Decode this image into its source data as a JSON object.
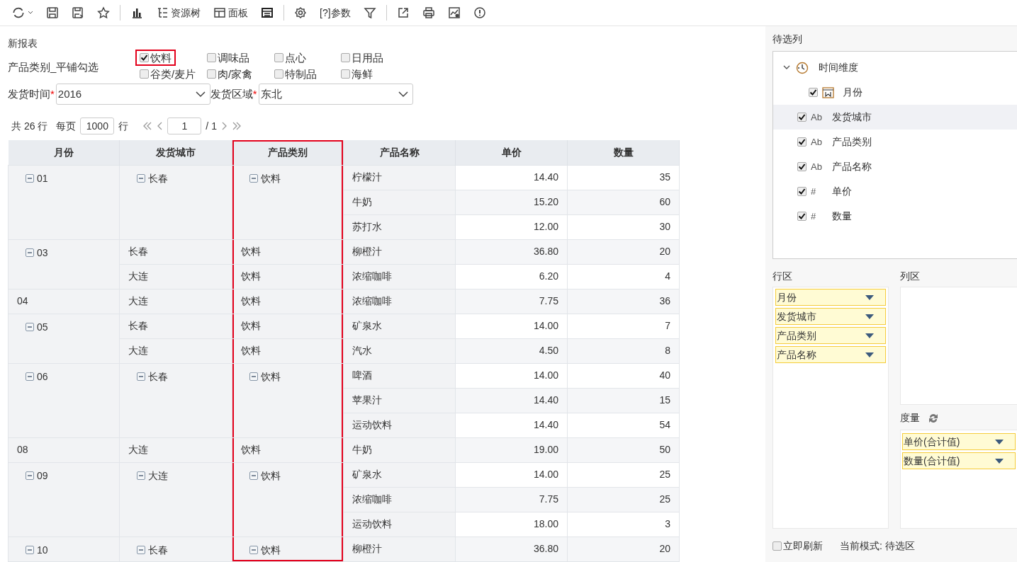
{
  "toolbar": [
    {
      "kind": "button",
      "caret": true
    },
    {
      "kind": "button"
    },
    {
      "kind": "button"
    },
    {
      "kind": "button"
    },
    {
      "kind": "separator"
    },
    {
      "kind": "button"
    },
    {
      "kind": "button",
      "label": "资源树"
    },
    {
      "kind": "button",
      "label": "面板"
    },
    {
      "kind": "button"
    },
    {
      "kind": "separator"
    },
    {
      "kind": "button"
    },
    {
      "kind": "button",
      "label": "[?]参数"
    },
    {
      "kind": "button"
    },
    {
      "kind": "separator"
    },
    {
      "kind": "button"
    },
    {
      "kind": "button"
    },
    {
      "kind": "button"
    },
    {
      "kind": "button"
    }
  ],
  "report_title": "新报表",
  "category_filter": {
    "label": "产品类别_平铺勾选",
    "options": [
      {
        "label": "饮料",
        "checked": true,
        "highlighted": true
      },
      {
        "label": "调味品",
        "checked": false,
        "highlighted": false
      },
      {
        "label": "点心",
        "checked": false,
        "highlighted": false
      },
      {
        "label": "日用品",
        "checked": false,
        "highlighted": false
      },
      {
        "label": "谷类/麦片",
        "checked": false,
        "highlighted": false
      },
      {
        "label": "肉/家禽",
        "checked": false,
        "highlighted": false
      },
      {
        "label": "特制品",
        "checked": false,
        "highlighted": false
      },
      {
        "label": "海鲜",
        "checked": false,
        "highlighted": false
      }
    ]
  },
  "selects": [
    {
      "label": "发货时间",
      "required_mark": "*",
      "value": "2016"
    },
    {
      "label": "发货区域",
      "required_mark": "*",
      "value": "东北"
    }
  ],
  "pager": {
    "total": "共 26 行",
    "per_page_label": "每页",
    "per_page": "1000",
    "rows_unit": "行",
    "page": "1",
    "page_count": "/ 1"
  },
  "table": {
    "columns": [
      {
        "label": "月份",
        "highlighted": false
      },
      {
        "label": "发货城市",
        "highlighted": false
      },
      {
        "label": "产品类别",
        "highlighted": true
      },
      {
        "label": "产品名称",
        "highlighted": false
      },
      {
        "label": "单价",
        "highlighted": false
      },
      {
        "label": "数量",
        "highlighted": false
      }
    ],
    "months": [
      {
        "label": "01",
        "collapsible": true,
        "cities": [
          {
            "label": "长春",
            "collapsible": true,
            "categories": [
              {
                "label": "饮料",
                "collapsible": true,
                "products": [
                  [
                    "柠檬汁",
                    "14.40",
                    "35"
                  ],
                  [
                    "牛奶",
                    "15.20",
                    "60"
                  ],
                  [
                    "苏打水",
                    "12.00",
                    "30"
                  ]
                ]
              }
            ]
          }
        ]
      },
      {
        "label": "03",
        "collapsible": true,
        "cities": [
          {
            "label": "长春",
            "collapsible": false,
            "categories": [
              {
                "label": "饮料",
                "collapsible": false,
                "products": [
                  [
                    "柳橙汁",
                    "36.80",
                    "20"
                  ]
                ]
              }
            ]
          },
          {
            "label": "大连",
            "collapsible": false,
            "categories": [
              {
                "label": "饮料",
                "collapsible": false,
                "products": [
                  [
                    "浓缩咖啡",
                    "6.20",
                    "4"
                  ]
                ]
              }
            ]
          }
        ]
      },
      {
        "label": "04",
        "collapsible": false,
        "cities": [
          {
            "label": "大连",
            "collapsible": false,
            "categories": [
              {
                "label": "饮料",
                "collapsible": false,
                "products": [
                  [
                    "浓缩咖啡",
                    "7.75",
                    "36"
                  ]
                ]
              }
            ]
          }
        ]
      },
      {
        "label": "05",
        "collapsible": true,
        "cities": [
          {
            "label": "长春",
            "collapsible": false,
            "categories": [
              {
                "label": "饮料",
                "collapsible": false,
                "products": [
                  [
                    "矿泉水",
                    "14.00",
                    "7"
                  ]
                ]
              }
            ]
          },
          {
            "label": "大连",
            "collapsible": false,
            "categories": [
              {
                "label": "饮料",
                "collapsible": false,
                "products": [
                  [
                    "汽水",
                    "4.50",
                    "8"
                  ]
                ]
              }
            ]
          }
        ]
      },
      {
        "label": "06",
        "collapsible": true,
        "cities": [
          {
            "label": "长春",
            "collapsible": true,
            "categories": [
              {
                "label": "饮料",
                "collapsible": true,
                "products": [
                  [
                    "啤酒",
                    "14.00",
                    "40"
                  ],
                  [
                    "苹果汁",
                    "14.40",
                    "15"
                  ],
                  [
                    "运动饮料",
                    "14.40",
                    "54"
                  ]
                ]
              }
            ]
          }
        ]
      },
      {
        "label": "08",
        "collapsible": false,
        "cities": [
          {
            "label": "大连",
            "collapsible": false,
            "categories": [
              {
                "label": "饮料",
                "collapsible": false,
                "products": [
                  [
                    "牛奶",
                    "19.00",
                    "50"
                  ]
                ]
              }
            ]
          }
        ]
      },
      {
        "label": "09",
        "collapsible": true,
        "cities": [
          {
            "label": "大连",
            "collapsible": true,
            "categories": [
              {
                "label": "饮料",
                "collapsible": true,
                "products": [
                  [
                    "矿泉水",
                    "14.00",
                    "25"
                  ],
                  [
                    "浓缩咖啡",
                    "7.75",
                    "25"
                  ],
                  [
                    "运动饮料",
                    "18.00",
                    "3"
                  ]
                ]
              }
            ]
          }
        ]
      },
      {
        "label": "10",
        "collapsible": true,
        "cities": [
          {
            "label": "长春",
            "collapsible": true,
            "categories": [
              {
                "label": "饮料",
                "collapsible": true,
                "products": [
                  [
                    "柳橙汁",
                    "36.80",
                    "20"
                  ]
                ]
              }
            ]
          }
        ]
      }
    ]
  },
  "field_panel": {
    "title": "待选列",
    "tree": [
      {
        "kind": "folder",
        "label": "时间维度",
        "expanded": true,
        "children": [
          {
            "kind": "date",
            "label": "月份",
            "checked": true,
            "selected": false
          }
        ]
      },
      {
        "kind": "field",
        "type_icon": "Ab",
        "label": "发货城市",
        "checked": true,
        "selected": true
      },
      {
        "kind": "field",
        "type_icon": "Ab",
        "label": "产品类别",
        "checked": true,
        "selected": false
      },
      {
        "kind": "field",
        "type_icon": "Ab",
        "label": "产品名称",
        "checked": true,
        "selected": false
      },
      {
        "kind": "field",
        "type_icon": "#",
        "label": "单价",
        "checked": true,
        "selected": false
      },
      {
        "kind": "field",
        "type_icon": "#",
        "label": "数量",
        "checked": true,
        "selected": false
      }
    ]
  },
  "row_zone": {
    "title": "行区",
    "items": [
      "月份",
      "发货城市",
      "产品类别",
      "产品名称"
    ]
  },
  "column_zone": {
    "title": "列区"
  },
  "measure_zone": {
    "title": "度量",
    "items": [
      "单价(合计值)",
      "数量(合计值)"
    ]
  },
  "footer": {
    "auto_refresh": {
      "label": "立即刷新",
      "checked": false
    },
    "mode": "当前模式: 待选区"
  }
}
